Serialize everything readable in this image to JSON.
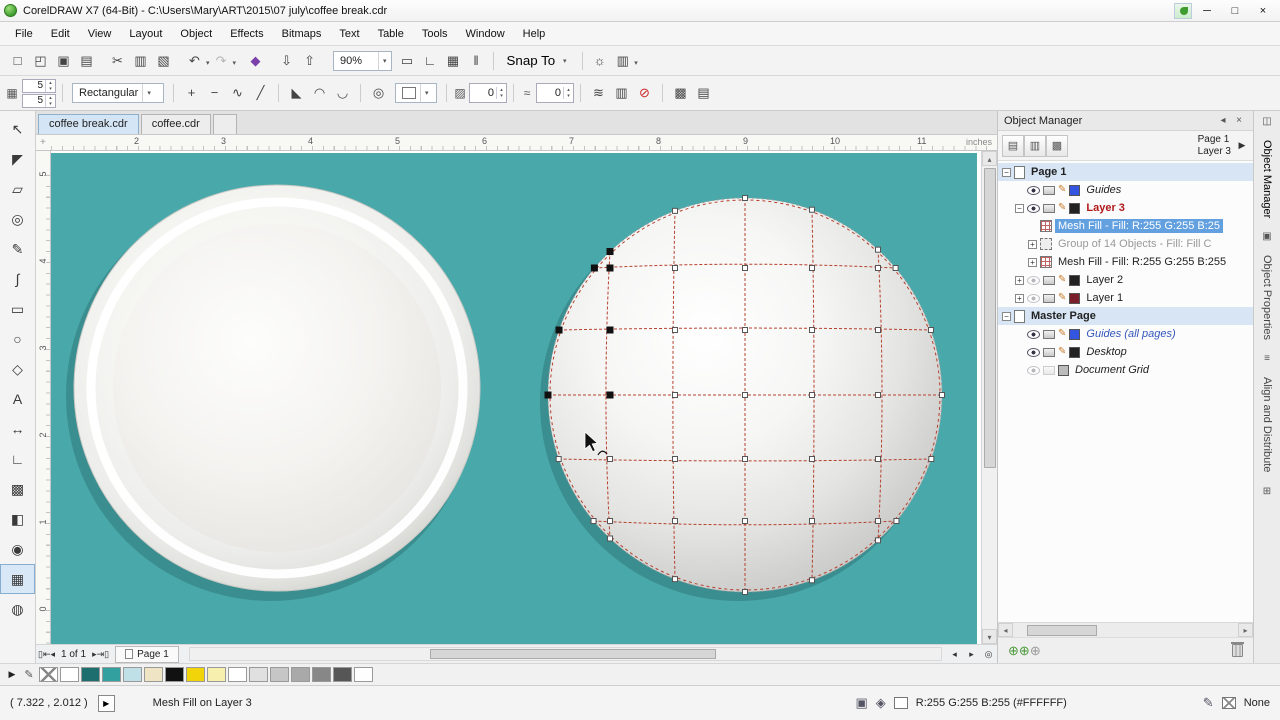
{
  "ui": {
    "caret": "▾",
    "up": "▴",
    "down": "▾",
    "left": "◂",
    "right": "▸",
    "play": "▶",
    "origin": "+"
  },
  "window": {
    "title": "CorelDRAW X7 (64-Bit) - C:\\Users\\Mary\\ART\\2015\\07 july\\coffee break.cdr",
    "minimize": "─",
    "maximize": "□",
    "close": "×"
  },
  "menu": {
    "items": [
      "File",
      "Edit",
      "View",
      "Layout",
      "Object",
      "Effects",
      "Bitmaps",
      "Text",
      "Table",
      "Tools",
      "Window",
      "Help"
    ]
  },
  "standard_toolbar": {
    "buttons": [
      {
        "name": "new-document-icon",
        "glyph": "□"
      },
      {
        "name": "open-icon",
        "glyph": "◰"
      },
      {
        "name": "save-icon",
        "glyph": "▣"
      },
      {
        "name": "print-icon",
        "glyph": "▤",
        "sep": true
      },
      {
        "name": "cut-icon",
        "glyph": "✂"
      },
      {
        "name": "copy-icon",
        "glyph": "▥"
      },
      {
        "name": "paste-icon",
        "glyph": "▧",
        "sep": true
      },
      {
        "name": "undo-icon",
        "glyph": "↶",
        "caret": true
      },
      {
        "name": "redo-icon",
        "glyph": "↷",
        "caret": true,
        "disabled": true,
        "sep": true
      },
      {
        "name": "app-launcher-icon",
        "glyph": "◆",
        "color": "#7a3fa8",
        "sep": true
      },
      {
        "name": "import-icon",
        "glyph": "⇩"
      },
      {
        "name": "export-icon",
        "glyph": "⇧",
        "sep": true
      }
    ],
    "zoom_value": "90%",
    "toggles": [
      {
        "name": "fullscreen-preview-icon",
        "glyph": "▭"
      },
      {
        "name": "show-rulers-icon",
        "glyph": "∟"
      },
      {
        "name": "show-grid-icon",
        "glyph": "▦"
      },
      {
        "name": "show-guidelines-icon",
        "glyph": "‖"
      }
    ],
    "snap_label": "Snap To",
    "end_buttons": [
      {
        "name": "options-icon",
        "glyph": "☼"
      },
      {
        "name": "launch-menu-icon",
        "glyph": "▥",
        "caret": true
      }
    ]
  },
  "property_bar": {
    "grid_glyph": "▦",
    "rows_value": "5",
    "cols_value": "5",
    "mesh_type": "Rectangular",
    "buttons1": [
      {
        "name": "add-intersection-icon",
        "glyph": "+"
      },
      {
        "name": "delete-intersection-icon",
        "glyph": "−"
      },
      {
        "name": "convert-to-curve-icon",
        "glyph": "∿"
      },
      {
        "name": "convert-to-line-icon",
        "glyph": "╱"
      }
    ],
    "buttons2": [
      {
        "name": "cusp-node-icon",
        "glyph": "◣"
      },
      {
        "name": "smooth-node-icon",
        "glyph": "◠"
      },
      {
        "name": "symmetrical-node-icon",
        "glyph": "◡"
      }
    ],
    "eyedropper_glyph": "◎",
    "transparency_value": "0",
    "acceleration_value": "0",
    "buttons3": [
      {
        "name": "smooth-mesh-color-icon",
        "glyph": "≋"
      },
      {
        "name": "copy-mesh-icon",
        "glyph": "▥"
      },
      {
        "name": "clear-mesh-icon",
        "glyph": "⊘",
        "color": "#cc2222"
      }
    ],
    "buttons4": [
      {
        "name": "wrap-options-icon",
        "glyph": "▩"
      },
      {
        "name": "more-options-icon",
        "glyph": "▤"
      }
    ]
  },
  "document_tabs": {
    "tabs": [
      {
        "label": "coffee break.cdr",
        "active": true
      },
      {
        "label": "coffee.cdr",
        "active": false
      }
    ]
  },
  "rulers": {
    "unit": "inches",
    "h_ticks": [
      "2",
      "3",
      "4",
      "5",
      "6",
      "7",
      "8",
      "9",
      "10",
      "11"
    ],
    "v_ticks": [
      "5",
      "4",
      "3",
      "2",
      "1",
      "0"
    ]
  },
  "toolbox": {
    "tools": [
      {
        "name": "pick-tool",
        "glyph": "↖"
      },
      {
        "name": "shape-tool",
        "glyph": "◤"
      },
      {
        "name": "crop-tool",
        "glyph": "▱"
      },
      {
        "name": "zoom-tool",
        "glyph": "◎"
      },
      {
        "name": "freehand-tool",
        "glyph": "✎"
      },
      {
        "name": "artistic-media-tool",
        "glyph": "∫"
      },
      {
        "name": "rectangle-tool",
        "glyph": "▭"
      },
      {
        "name": "ellipse-tool",
        "glyph": "○"
      },
      {
        "name": "polygon-tool",
        "glyph": "◇"
      },
      {
        "name": "text-tool",
        "glyph": "A"
      },
      {
        "name": "dimension-tool",
        "glyph": "↔"
      },
      {
        "name": "connector-tool",
        "glyph": "∟"
      },
      {
        "name": "drop-shadow-tool",
        "glyph": "▩"
      },
      {
        "name": "transparency-tool",
        "glyph": "◧"
      },
      {
        "name": "color-eyedropper-tool",
        "glyph": "◉"
      },
      {
        "name": "mesh-fill-tool",
        "glyph": "▦",
        "active": true
      },
      {
        "name": "fill-tool",
        "glyph": "◍"
      }
    ]
  },
  "canvas": {
    "background": "#49a8aa"
  },
  "nav": {
    "buttons_left": [
      {
        "name": "page-sheet-icon",
        "glyph": "▯"
      },
      {
        "name": "first-page-icon",
        "glyph": "⇤"
      },
      {
        "name": "prev-page-icon",
        "glyph": "◂"
      }
    ],
    "label": "1 of 1",
    "buttons_right": [
      {
        "name": "next-page-icon",
        "glyph": "▸"
      },
      {
        "name": "last-page-icon",
        "glyph": "⇥"
      },
      {
        "name": "add-page-icon",
        "glyph": "▯"
      }
    ],
    "page_tab": "Page 1",
    "zoom_glyph": "◎"
  },
  "object_manager": {
    "title": "Object Manager",
    "toolbar_icons": [
      {
        "name": "layer-manager-view-icon",
        "glyph": "▤"
      },
      {
        "name": "show-object-properties-icon",
        "glyph": "▥"
      },
      {
        "name": "edit-across-layers-icon",
        "glyph": "▩"
      }
    ],
    "header_page": "Page 1",
    "header_layer": "Layer 3",
    "rows": [
      {
        "label": "Page 1",
        "kind": "page",
        "expander": "−",
        "bold": true,
        "band": true
      },
      {
        "label": "Guides",
        "kind": "guides",
        "italic": true,
        "chip": "#3355e0"
      },
      {
        "label": "Layer 3",
        "kind": "layer",
        "expander": "−",
        "bold": true,
        "labelColor": "#b01a1a",
        "chip": "#222222"
      },
      {
        "label": "Mesh Fill - Fill: R:255 G:255 B:25",
        "kind": "mesh",
        "selected": true
      },
      {
        "label": "Group of 14 Objects - Fill: Fill C",
        "kind": "group",
        "expander": "+",
        "dim": true
      },
      {
        "label": "Mesh Fill - Fill: R:255 G:255 B:255",
        "kind": "mesh",
        "expander": "+"
      },
      {
        "label": "Layer 2",
        "kind": "layer",
        "expander": "+",
        "eyeDim": true,
        "chip": "#222222"
      },
      {
        "label": "Layer 1",
        "kind": "layer",
        "expander": "+",
        "eyeDim": true,
        "chip": "#7a1f2b"
      },
      {
        "label": "Master Page",
        "kind": "page",
        "expander": "−",
        "bold": true,
        "band": true
      },
      {
        "label": "Guides (all pages)",
        "kind": "guides",
        "italic": true,
        "chip": "#3355e0",
        "labelColor": "#3355bb"
      },
      {
        "label": "Desktop",
        "kind": "layer",
        "italic": true,
        "chip": "#222222"
      },
      {
        "label": "Document Grid",
        "kind": "grid",
        "italic": true,
        "eyeDim": true,
        "printDim": true,
        "chip": "#bbbbbb"
      }
    ],
    "footer_icons": [
      {
        "name": "new-layer-icon",
        "glyph": "⊕",
        "color": "#4a9a3a"
      },
      {
        "name": "new-master-layer-all-icon",
        "glyph": "⊕",
        "color": "#4a9a3a"
      },
      {
        "name": "new-master-layer-odd-icon",
        "glyph": "⊕",
        "color": "#999999"
      }
    ]
  },
  "right_strip": {
    "items": [
      {
        "kind": "icon",
        "glyph": "◫",
        "name": "dock-collapse-icon"
      },
      {
        "kind": "tab",
        "label": "Object Manager",
        "active": true
      },
      {
        "kind": "icon",
        "glyph": "▣",
        "name": "object-properties-dock-icon"
      },
      {
        "kind": "tab",
        "label": "Object Properties",
        "active": false
      },
      {
        "kind": "icon",
        "glyph": "≡",
        "name": "align-dock-icon"
      },
      {
        "kind": "tab",
        "label": "Align and Distribute",
        "active": false
      },
      {
        "kind": "icon",
        "glyph": "⊞",
        "name": "docker-extra-icon"
      }
    ]
  },
  "palette": {
    "colors": [
      "none",
      "#ffffff",
      "#1d6e6e",
      "#33a0a0",
      "#bfe0e6",
      "#efe4c4",
      "#111111",
      "#f2d40a",
      "#f6efae",
      "#ffffff",
      "#e0e0e0",
      "#c6c6c6",
      "#a9a9a9",
      "#878787",
      "#565656",
      "#fefefe"
    ]
  },
  "status": {
    "coords": "( 7.322 , 2.012 )",
    "message": "Mesh Fill on Layer 3",
    "fill_value": "R:255 G:255 B:255 (#FFFFFF)",
    "outline_value": "None"
  }
}
